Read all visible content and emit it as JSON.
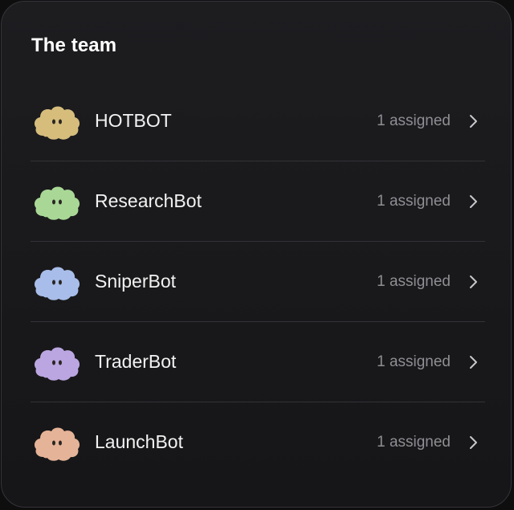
{
  "team": {
    "title": "The team",
    "members": [
      {
        "name": "HOTBOT",
        "assigned": "1 assigned",
        "avatar_color": "#d6bd7c",
        "avatar_icon": "cloud-face-icon"
      },
      {
        "name": "ResearchBot",
        "assigned": "1 assigned",
        "avatar_color": "#a9d896",
        "avatar_icon": "cloud-face-icon"
      },
      {
        "name": "SniperBot",
        "assigned": "1 assigned",
        "avatar_color": "#a8bde9",
        "avatar_icon": "cloud-face-icon"
      },
      {
        "name": "TraderBot",
        "assigned": "1 assigned",
        "avatar_color": "#bba6e1",
        "avatar_icon": "cloud-face-icon"
      },
      {
        "name": "LaunchBot",
        "assigned": "1 assigned",
        "avatar_color": "#e5b397",
        "avatar_icon": "cloud-face-icon"
      }
    ]
  },
  "colors": {
    "background": "#0e0e0f",
    "panel": "#1b1b1d",
    "divider": "#333338",
    "text_primary": "#f2f2f2",
    "text_secondary": "#8e8e93"
  }
}
